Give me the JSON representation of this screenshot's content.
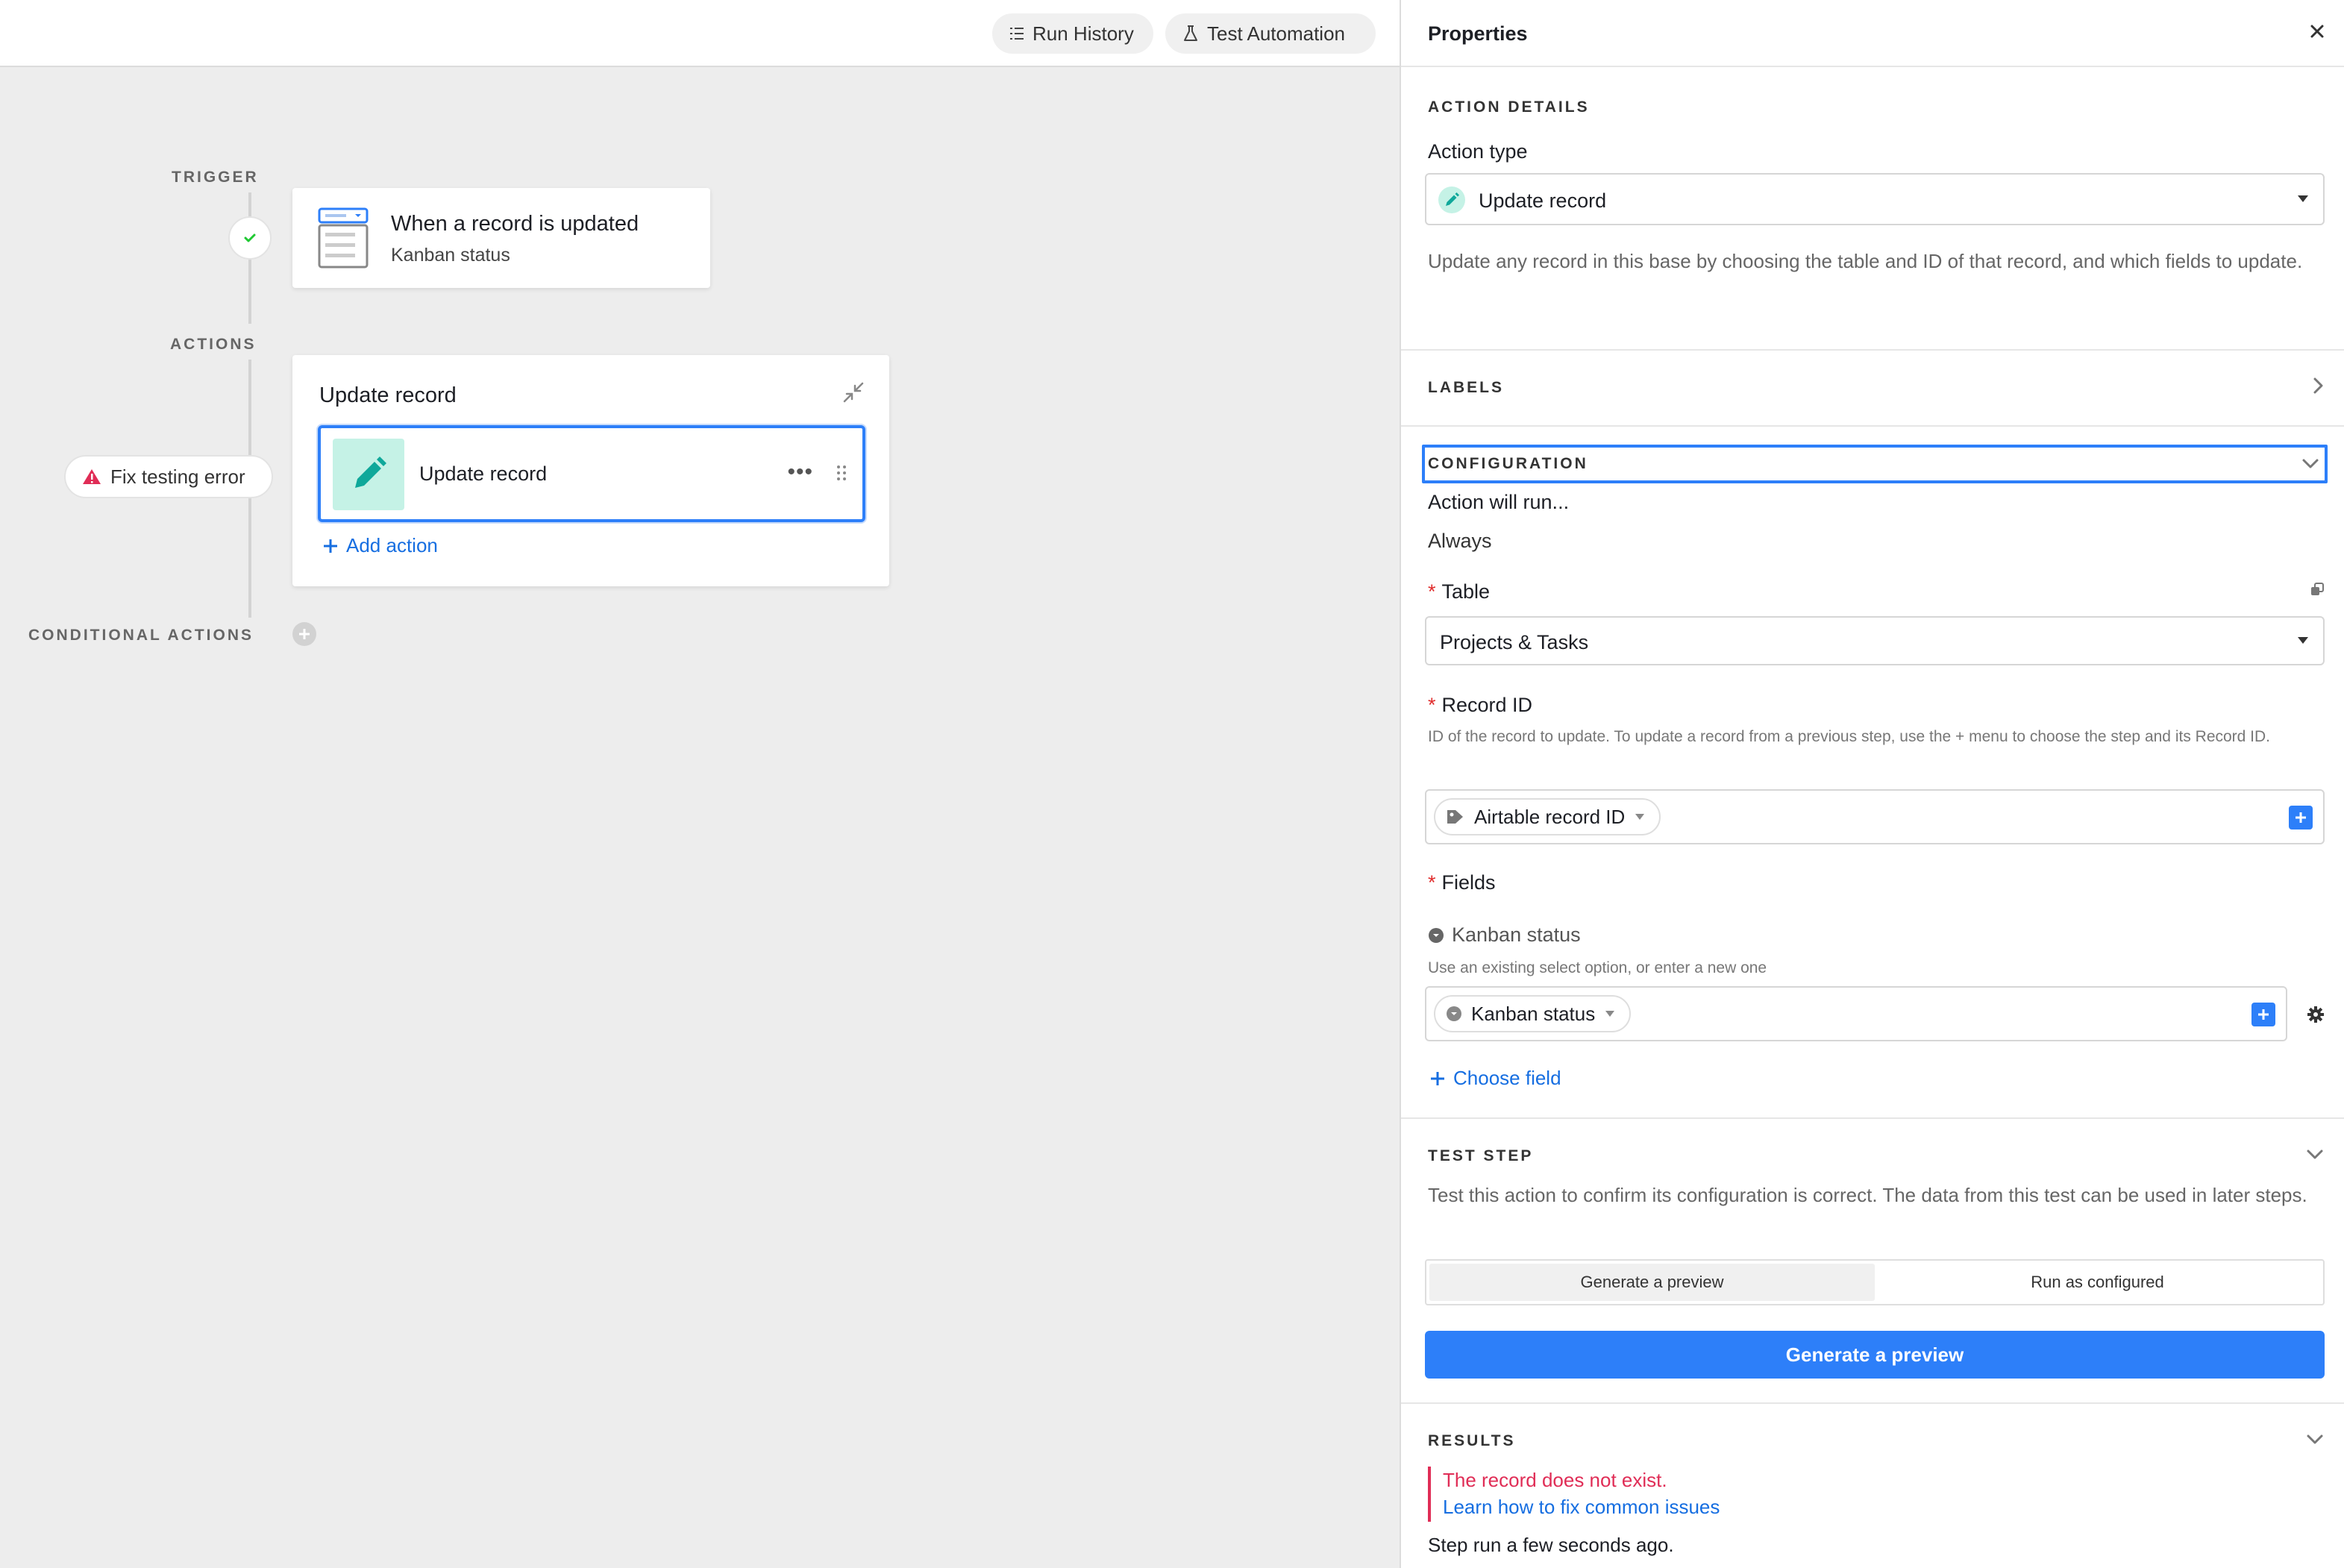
{
  "topbar": {
    "run_history_label": "Run History",
    "test_automation_label": "Test Automation"
  },
  "canvas": {
    "trigger_label": "TRIGGER",
    "actions_label": "ACTIONS",
    "conditional_actions_label": "CONDITIONAL ACTIONS",
    "trigger_card": {
      "title": "When a record is updated",
      "subtitle": "Kanban status",
      "status": "success"
    },
    "action_card": {
      "title": "Update record",
      "item_label": "Update record",
      "more_label": "•••",
      "add_action_label": "Add action"
    },
    "fix_error_label": "Fix testing error"
  },
  "panel": {
    "title": "Properties",
    "action_details": {
      "heading": "ACTION DETAILS",
      "action_type_label": "Action type",
      "action_type_value": "Update record",
      "description": "Update any record in this base by choosing the table and ID of that record, and which fields to update."
    },
    "labels_heading": "LABELS",
    "configuration": {
      "heading": "CONFIGURATION",
      "will_run_label": "Action will run...",
      "will_run_value": "Always",
      "table_label": "Table",
      "table_value": "Projects & Tasks",
      "record_id_label": "Record ID",
      "record_id_help": "ID of the record to update. To update a record from a previous step, use the + menu to choose the step and its Record ID.",
      "record_id_token": "Airtable record ID",
      "fields_label": "Fields",
      "field_name": "Kanban status",
      "field_help": "Use an existing select option, or enter a new one",
      "field_token": "Kanban status",
      "choose_field_label": "Choose field"
    },
    "test_step": {
      "heading": "TEST STEP",
      "description": "Test this action to confirm its configuration is correct. The data from this test can be used in later steps.",
      "segments": [
        "Generate a preview",
        "Run as configured"
      ],
      "button_label": "Generate a preview"
    },
    "results": {
      "heading": "RESULTS",
      "error": "The record does not exist.",
      "help_link": "Learn how to fix common issues",
      "step_run": "Step run a few seconds ago."
    }
  },
  "colors": {
    "accent": "#2d7ff9",
    "link": "#166ee1",
    "error": "#e02d56",
    "success": "#20c933",
    "teal": "#0fa89a"
  }
}
